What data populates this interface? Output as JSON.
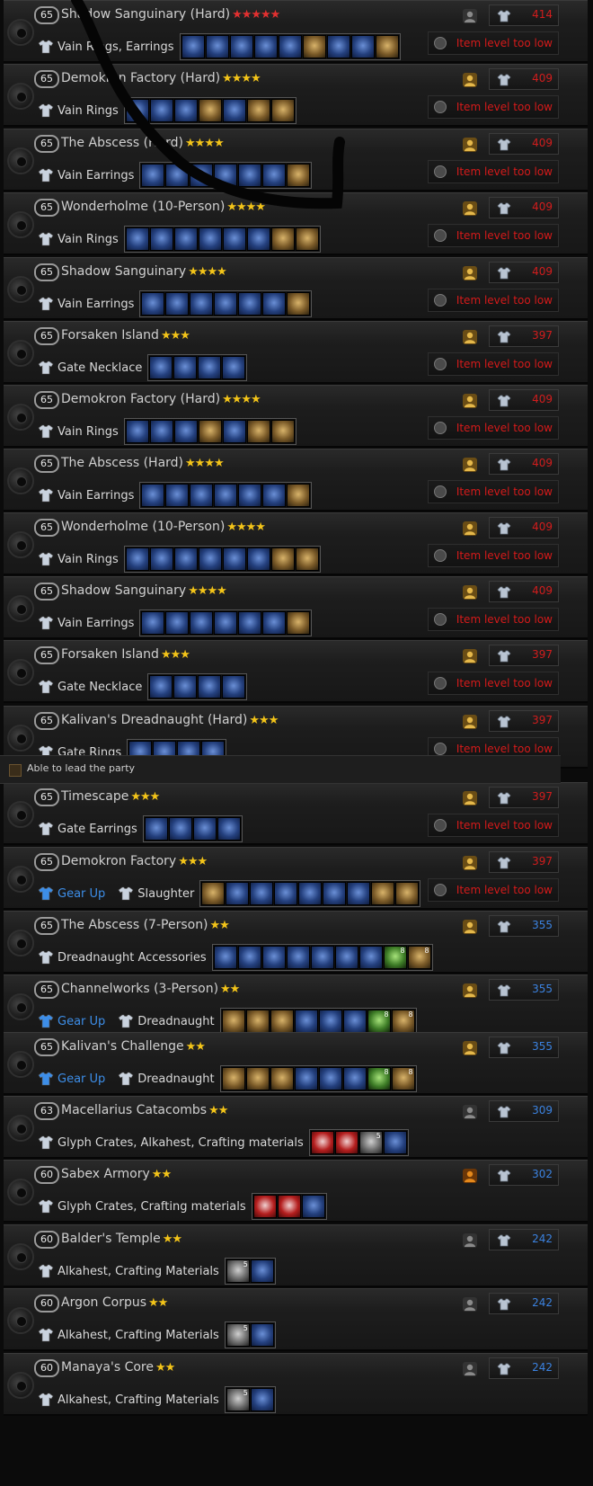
{
  "banner": {
    "label": "Able to lead the party"
  },
  "dungeons": [
    {
      "level": "65",
      "name": "Shadow Sanguinary (Hard)",
      "stars": 5,
      "star_color": "red",
      "party_icon": "gray",
      "ilvl": "414",
      "ilvl_color": "red",
      "gear_up": "",
      "loot": "Vain Rings, Earrings",
      "items": [
        "blue",
        "blue",
        "blue",
        "blue",
        "blue",
        "gold",
        "blue",
        "blue",
        "gold"
      ],
      "counts": {},
      "warning": "Item level too low"
    },
    {
      "level": "65",
      "name": "Demokron Factory (Hard)",
      "stars": 4,
      "star_color": "gold",
      "party_icon": "gold",
      "ilvl": "409",
      "ilvl_color": "red",
      "gear_up": "",
      "loot": "Vain Rings",
      "items": [
        "blue",
        "blue",
        "blue",
        "gold",
        "blue",
        "gold",
        "gold"
      ],
      "counts": {},
      "warning": "Item level too low"
    },
    {
      "level": "65",
      "name": "The Abscess (Hard)",
      "stars": 4,
      "star_color": "gold",
      "party_icon": "gold",
      "ilvl": "409",
      "ilvl_color": "red",
      "gear_up": "",
      "loot": "Vain Earrings",
      "items": [
        "blue",
        "blue",
        "blue",
        "blue",
        "blue",
        "blue",
        "gold"
      ],
      "counts": {},
      "warning": "Item level too low"
    },
    {
      "level": "65",
      "name": "Wonderholme (10-Person)",
      "stars": 4,
      "star_color": "gold",
      "party_icon": "gold",
      "ilvl": "409",
      "ilvl_color": "red",
      "gear_up": "",
      "loot": "Vain Rings",
      "items": [
        "blue",
        "blue",
        "blue",
        "blue",
        "blue",
        "blue",
        "gold",
        "gold"
      ],
      "counts": {},
      "warning": "Item level too low"
    },
    {
      "level": "65",
      "name": "Shadow Sanguinary",
      "stars": 4,
      "star_color": "gold",
      "party_icon": "gold",
      "ilvl": "409",
      "ilvl_color": "red",
      "gear_up": "",
      "loot": "Vain Earrings",
      "items": [
        "blue",
        "blue",
        "blue",
        "blue",
        "blue",
        "blue",
        "gold"
      ],
      "counts": {},
      "warning": "Item level too low"
    },
    {
      "level": "65",
      "name": "Forsaken Island",
      "stars": 3,
      "star_color": "gold",
      "party_icon": "gold",
      "ilvl": "397",
      "ilvl_color": "red",
      "gear_up": "",
      "loot": "Gate Necklace",
      "items": [
        "blue",
        "blue",
        "blue",
        "blue"
      ],
      "counts": {},
      "warning": "Item level too low"
    },
    {
      "level": "65",
      "name": "Demokron Factory (Hard)",
      "stars": 4,
      "star_color": "gold",
      "party_icon": "gold",
      "ilvl": "409",
      "ilvl_color": "red",
      "gear_up": "",
      "loot": "Vain Rings",
      "items": [
        "blue",
        "blue",
        "blue",
        "gold",
        "blue",
        "gold",
        "gold"
      ],
      "counts": {},
      "warning": "Item level too low"
    },
    {
      "level": "65",
      "name": "The Abscess (Hard)",
      "stars": 4,
      "star_color": "gold",
      "party_icon": "gold",
      "ilvl": "409",
      "ilvl_color": "red",
      "gear_up": "",
      "loot": "Vain Earrings",
      "items": [
        "blue",
        "blue",
        "blue",
        "blue",
        "blue",
        "blue",
        "gold"
      ],
      "counts": {},
      "warning": "Item level too low"
    },
    {
      "level": "65",
      "name": "Wonderholme (10-Person)",
      "stars": 4,
      "star_color": "gold",
      "party_icon": "gold",
      "ilvl": "409",
      "ilvl_color": "red",
      "gear_up": "",
      "loot": "Vain Rings",
      "items": [
        "blue",
        "blue",
        "blue",
        "blue",
        "blue",
        "blue",
        "gold",
        "gold"
      ],
      "counts": {},
      "warning": "Item level too low"
    },
    {
      "level": "65",
      "name": "Shadow Sanguinary",
      "stars": 4,
      "star_color": "gold",
      "party_icon": "gold",
      "ilvl": "409",
      "ilvl_color": "red",
      "gear_up": "",
      "loot": "Vain Earrings",
      "items": [
        "blue",
        "blue",
        "blue",
        "blue",
        "blue",
        "blue",
        "gold"
      ],
      "counts": {},
      "warning": "Item level too low"
    },
    {
      "level": "65",
      "name": "Forsaken Island",
      "stars": 3,
      "star_color": "gold",
      "party_icon": "gold",
      "ilvl": "397",
      "ilvl_color": "red",
      "gear_up": "",
      "loot": "Gate Necklace",
      "items": [
        "blue",
        "blue",
        "blue",
        "blue"
      ],
      "counts": {},
      "warning": "Item level too low"
    },
    {
      "level": "65",
      "name": "Kalivan's Dreadnaught (Hard)",
      "stars": 3,
      "star_color": "gold",
      "party_icon": "gold",
      "ilvl": "397",
      "ilvl_color": "red",
      "gear_up": "",
      "loot": "Gate Rings",
      "items": [
        "blue",
        "blue",
        "blue",
        "blue"
      ],
      "counts": {},
      "warning": "Item level too low"
    },
    {
      "level": "65",
      "name": "Timescape",
      "stars": 3,
      "star_color": "gold",
      "party_icon": "gold",
      "ilvl": "397",
      "ilvl_color": "red",
      "gear_up": "",
      "loot": "Gate Earrings",
      "items": [
        "blue",
        "blue",
        "blue",
        "blue"
      ],
      "counts": {},
      "warning": "Item level too low"
    },
    {
      "level": "65",
      "name": "Demokron Factory",
      "stars": 3,
      "star_color": "gold",
      "party_icon": "gold",
      "ilvl": "397",
      "ilvl_color": "red",
      "gear_up": "Gear Up",
      "loot": "Slaughter",
      "items": [
        "gold",
        "blue",
        "blue",
        "blue",
        "blue",
        "blue",
        "blue",
        "gold",
        "gold"
      ],
      "counts": {},
      "warning": "Item level too low"
    },
    {
      "level": "65",
      "name": "The Abscess (7-Person)",
      "stars": 2,
      "star_color": "gold",
      "party_icon": "gold",
      "ilvl": "355",
      "ilvl_color": "blue",
      "gear_up": "",
      "loot": "Dreadnaught Accessories",
      "items": [
        "blue",
        "blue",
        "blue",
        "blue",
        "blue",
        "blue",
        "blue",
        "green",
        "gold"
      ],
      "counts": {
        "7": "8",
        "8": "8"
      },
      "warning": ""
    },
    {
      "level": "65",
      "name": "Channelworks (3-Person)",
      "stars": 2,
      "star_color": "gold",
      "party_icon": "gold",
      "ilvl": "355",
      "ilvl_color": "blue",
      "gear_up": "Gear Up",
      "loot": "Dreadnaught",
      "items": [
        "gold",
        "gold",
        "gold",
        "blue",
        "blue",
        "blue",
        "green",
        "gold"
      ],
      "counts": {
        "6": "8",
        "7": "8"
      },
      "warning": ""
    },
    {
      "level": "65",
      "name": "Kalivan's Challenge",
      "stars": 2,
      "star_color": "gold",
      "party_icon": "gold",
      "ilvl": "355",
      "ilvl_color": "blue",
      "gear_up": "Gear Up",
      "loot": "Dreadnaught",
      "items": [
        "gold",
        "gold",
        "gold",
        "blue",
        "blue",
        "blue",
        "green",
        "gold"
      ],
      "counts": {
        "6": "8",
        "7": "8"
      },
      "warning": ""
    },
    {
      "level": "63",
      "name": "Macellarius Catacombs",
      "stars": 2,
      "star_color": "gold",
      "party_icon": "gray",
      "ilvl": "309",
      "ilvl_color": "blue",
      "gear_up": "",
      "loot": "Glyph Crates, Alkahest, Crafting materials",
      "items": [
        "red",
        "red",
        "gray",
        "blue"
      ],
      "counts": {
        "2": "5"
      },
      "warning": ""
    },
    {
      "level": "60",
      "name": "Sabex Armory",
      "stars": 2,
      "star_color": "gold",
      "party_icon": "orange",
      "ilvl": "302",
      "ilvl_color": "blue",
      "gear_up": "",
      "loot": "Glyph Crates, Crafting materials",
      "items": [
        "red",
        "red",
        "blue"
      ],
      "counts": {},
      "warning": ""
    },
    {
      "level": "60",
      "name": "Balder's Temple",
      "stars": 2,
      "star_color": "gold",
      "party_icon": "gray",
      "ilvl": "242",
      "ilvl_color": "blue",
      "gear_up": "",
      "loot": "Alkahest, Crafting Materials",
      "items": [
        "gray",
        "blue"
      ],
      "counts": {
        "0": "5"
      },
      "warning": ""
    },
    {
      "level": "60",
      "name": "Argon Corpus",
      "stars": 2,
      "star_color": "gold",
      "party_icon": "gray",
      "ilvl": "242",
      "ilvl_color": "blue",
      "gear_up": "",
      "loot": "Alkahest, Crafting Materials",
      "items": [
        "gray",
        "blue"
      ],
      "counts": {
        "0": "5"
      },
      "warning": ""
    },
    {
      "level": "60",
      "name": "Manaya's Core",
      "stars": 2,
      "star_color": "gold",
      "party_icon": "gray",
      "ilvl": "242",
      "ilvl_color": "blue",
      "gear_up": "",
      "loot": "Alkahest, Crafting Materials",
      "items": [
        "gray",
        "blue"
      ],
      "counts": {
        "0": "5"
      },
      "warning": ""
    }
  ]
}
